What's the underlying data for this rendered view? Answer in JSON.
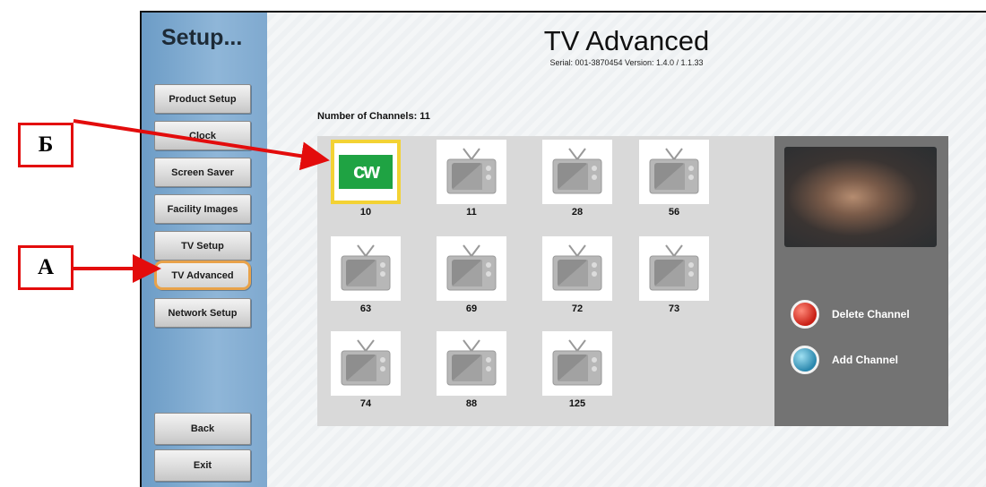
{
  "sidebar": {
    "title": "Setup...",
    "items": [
      {
        "label": "Product Setup"
      },
      {
        "label": "Clock"
      },
      {
        "label": "Screen Saver"
      },
      {
        "label": "Facility Images"
      },
      {
        "label": "TV Setup"
      },
      {
        "label": "TV Advanced",
        "active": true
      },
      {
        "label": "Network Setup"
      }
    ],
    "back_label": "Back",
    "exit_label": "Exit"
  },
  "header": {
    "title": "TV Advanced",
    "serial_version": "Serial: 001-3870454   Version: 1.4.0 / 1.1.33"
  },
  "channels": {
    "count_label": "Number of Channels: 11",
    "items": [
      {
        "number": "10",
        "logo": "cw",
        "selected": true
      },
      {
        "number": "11",
        "logo": "tv-icon"
      },
      {
        "number": "28",
        "logo": "tv-icon"
      },
      {
        "number": "56",
        "logo": "tv-icon"
      },
      {
        "number": "63",
        "logo": "tv-icon"
      },
      {
        "number": "69",
        "logo": "tv-icon"
      },
      {
        "number": "72",
        "logo": "tv-icon"
      },
      {
        "number": "73",
        "logo": "tv-icon"
      },
      {
        "number": "74",
        "logo": "tv-icon"
      },
      {
        "number": "88",
        "logo": "tv-icon"
      },
      {
        "number": "125",
        "logo": "tv-icon"
      }
    ],
    "cw_logo_text": "cw"
  },
  "actions": {
    "delete_label": "Delete Channel",
    "add_label": "Add Channel"
  },
  "annotations": {
    "b_label": "Б",
    "a_label": "А"
  },
  "colors": {
    "sidebar": "#7fa9cf",
    "selected_border": "#f3d234",
    "active_border": "#e8a24a",
    "delete": "#c81e14",
    "add": "#2a87ad",
    "annotation": "#e30c0c",
    "cw_green": "#1fa343"
  }
}
